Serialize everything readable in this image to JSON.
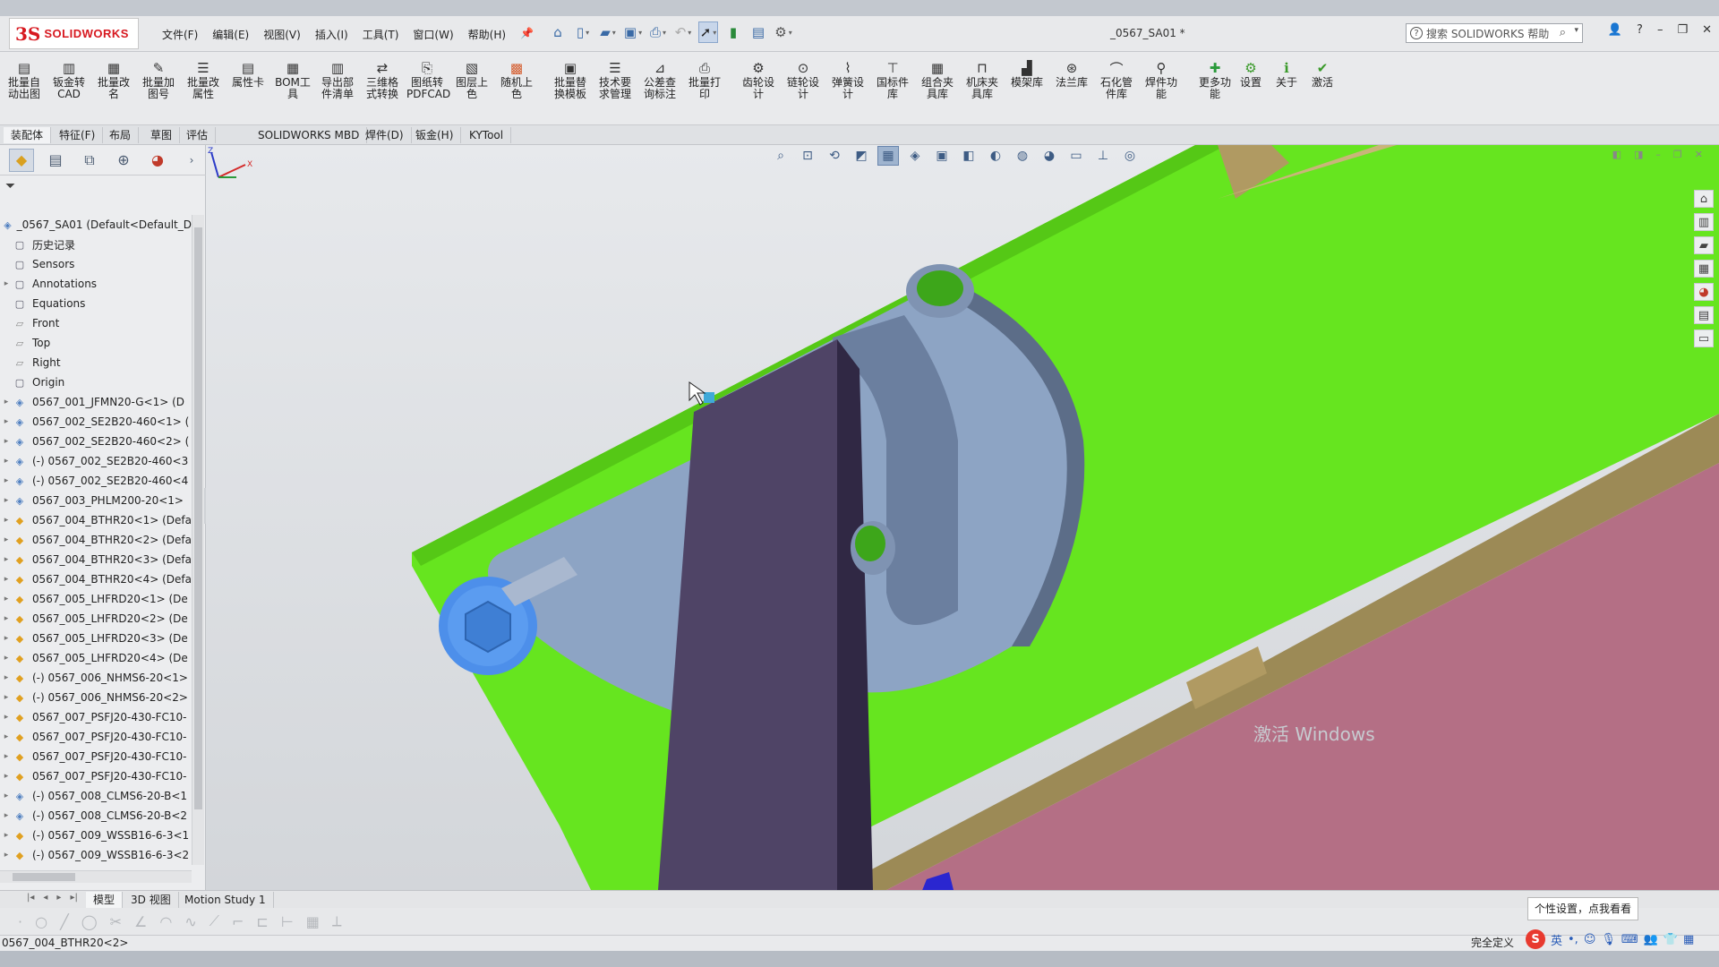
{
  "app": {
    "brand": "SOLIDWORKS",
    "doc_title": "_0567_SA01 *",
    "search_placeholder": "搜索 SOLIDWORKS 帮助"
  },
  "menu": [
    "文件(F)",
    "编辑(E)",
    "视图(V)",
    "插入(I)",
    "工具(T)",
    "窗口(W)",
    "帮助(H)"
  ],
  "ribbon": [
    {
      "label": "批量自动出图",
      "icon": "drawing-icon"
    },
    {
      "label": "钣金转CAD",
      "icon": "sheetmetal-icon"
    },
    {
      "label": "批量改名",
      "icon": "rename-icon"
    },
    {
      "label": "批量加图号",
      "icon": "number-icon"
    },
    {
      "label": "批量改属性",
      "icon": "properties-icon"
    },
    {
      "label": "属性卡",
      "icon": "card-icon"
    },
    {
      "label": "BOM工具",
      "icon": "bom-icon"
    },
    {
      "label": "导出部件清单",
      "icon": "export-icon"
    },
    {
      "label": "三维格式转换",
      "icon": "convert-icon"
    },
    {
      "label": "图纸转PDFCAD",
      "icon": "pdf-icon"
    },
    {
      "label": "图层上色",
      "icon": "layer-icon"
    },
    {
      "label": "随机上色",
      "icon": "color-icon"
    },
    {
      "label": "批量替换模板",
      "icon": "template-icon"
    },
    {
      "label": "技术要求管理",
      "icon": "tech-icon"
    },
    {
      "label": "公差查询标注",
      "icon": "tolerance-icon"
    },
    {
      "label": "批量打印",
      "icon": "print-icon"
    },
    {
      "label": "齿轮设计",
      "icon": "gear-icon"
    },
    {
      "label": "链轮设计",
      "icon": "sprocket-icon"
    },
    {
      "label": "弹簧设计",
      "icon": "spring-icon"
    },
    {
      "label": "国标件库",
      "icon": "standard-icon"
    },
    {
      "label": "组合夹具库",
      "icon": "fixture-icon"
    },
    {
      "label": "机床夹具库",
      "icon": "clamp-icon"
    },
    {
      "label": "模架库",
      "icon": "mold-icon"
    },
    {
      "label": "法兰库",
      "icon": "flange-icon"
    },
    {
      "label": "石化管件库",
      "icon": "pipe-icon"
    },
    {
      "label": "焊件功能",
      "icon": "weld-icon"
    },
    {
      "label": "更多功能",
      "icon": "plus-icon"
    },
    {
      "label": "设置",
      "icon": "settings-icon"
    },
    {
      "label": "关于",
      "icon": "info-icon"
    },
    {
      "label": "激活",
      "icon": "activate-icon"
    }
  ],
  "command_tabs": [
    "装配体",
    "特征(F)",
    "布局",
    "草图",
    "评估",
    "SOLIDWORKS MBD",
    "焊件(D)",
    "钣金(H)",
    "KYTool"
  ],
  "active_command_tab": "装配体",
  "tree": [
    {
      "label": "_0567_SA01  (Default<Default_D",
      "kind": "asm",
      "exp": ""
    },
    {
      "label": "历史记录",
      "kind": "gen",
      "exp": ""
    },
    {
      "label": "Sensors",
      "kind": "gen",
      "exp": ""
    },
    {
      "label": "Annotations",
      "kind": "gen",
      "exp": "▸"
    },
    {
      "label": "Equations",
      "kind": "gen",
      "exp": ""
    },
    {
      "label": "Front",
      "kind": "plane",
      "exp": ""
    },
    {
      "label": "Top",
      "kind": "plane",
      "exp": ""
    },
    {
      "label": "Right",
      "kind": "plane",
      "exp": ""
    },
    {
      "label": "Origin",
      "kind": "gen",
      "exp": ""
    },
    {
      "label": "0567_001_JFMN20-G<1> (D",
      "kind": "asm",
      "exp": "▸"
    },
    {
      "label": "0567_002_SE2B20-460<1> (",
      "kind": "asm",
      "exp": "▸"
    },
    {
      "label": "0567_002_SE2B20-460<2> (",
      "kind": "asm",
      "exp": "▸"
    },
    {
      "label": "(-) 0567_002_SE2B20-460<3",
      "kind": "asm",
      "exp": "▸"
    },
    {
      "label": "(-) 0567_002_SE2B20-460<4",
      "kind": "asm",
      "exp": "▸"
    },
    {
      "label": "0567_003_PHLM200-20<1>",
      "kind": "asm",
      "exp": "▸"
    },
    {
      "label": "0567_004_BTHR20<1> (Defa",
      "kind": "part",
      "exp": "▸"
    },
    {
      "label": "0567_004_BTHR20<2> (Defa",
      "kind": "part",
      "exp": "▸"
    },
    {
      "label": "0567_004_BTHR20<3> (Defa",
      "kind": "part",
      "exp": "▸"
    },
    {
      "label": "0567_004_BTHR20<4> (Defa",
      "kind": "part",
      "exp": "▸"
    },
    {
      "label": "0567_005_LHFRD20<1> (De",
      "kind": "part",
      "exp": "▸"
    },
    {
      "label": "0567_005_LHFRD20<2> (De",
      "kind": "part",
      "exp": "▸"
    },
    {
      "label": "0567_005_LHFRD20<3> (De",
      "kind": "part",
      "exp": "▸"
    },
    {
      "label": "0567_005_LHFRD20<4> (De",
      "kind": "part",
      "exp": "▸"
    },
    {
      "label": "(-) 0567_006_NHMS6-20<1>",
      "kind": "part",
      "exp": "▸"
    },
    {
      "label": "(-) 0567_006_NHMS6-20<2>",
      "kind": "part",
      "exp": "▸"
    },
    {
      "label": "0567_007_PSFJ20-430-FC10-",
      "kind": "part",
      "exp": "▸"
    },
    {
      "label": "0567_007_PSFJ20-430-FC10-",
      "kind": "part",
      "exp": "▸"
    },
    {
      "label": "0567_007_PSFJ20-430-FC10-",
      "kind": "part",
      "exp": "▸"
    },
    {
      "label": "0567_007_PSFJ20-430-FC10-",
      "kind": "part",
      "exp": "▸"
    },
    {
      "label": "(-) 0567_008_CLMS6-20-B<1",
      "kind": "asm",
      "exp": "▸"
    },
    {
      "label": "(-) 0567_008_CLMS6-20-B<2",
      "kind": "asm",
      "exp": "▸"
    },
    {
      "label": "(-) 0567_009_WSSB16-6-3<1",
      "kind": "part",
      "exp": "▸"
    },
    {
      "label": "(-) 0567_009_WSSB16-6-3<2",
      "kind": "part",
      "exp": "▸"
    }
  ],
  "bottom_tabs": [
    "模型",
    "3D 视图",
    "Motion Study 1"
  ],
  "active_bottom_tab": "模型",
  "status": {
    "selection": "0567_004_BTHR20<2>",
    "right": "完全定义"
  },
  "watermark": "激活 Windows",
  "tooltip": "个性设置，点我看看",
  "tray": {
    "ime": "英"
  },
  "colors": {
    "plate_green": "#66e51f",
    "bracket_blue": "#8da4c4",
    "bar_purple": "#4f4466",
    "base_pink": "#b46f85",
    "rail_tan": "#b09a62",
    "bolt_blue": "#4d8fea"
  }
}
